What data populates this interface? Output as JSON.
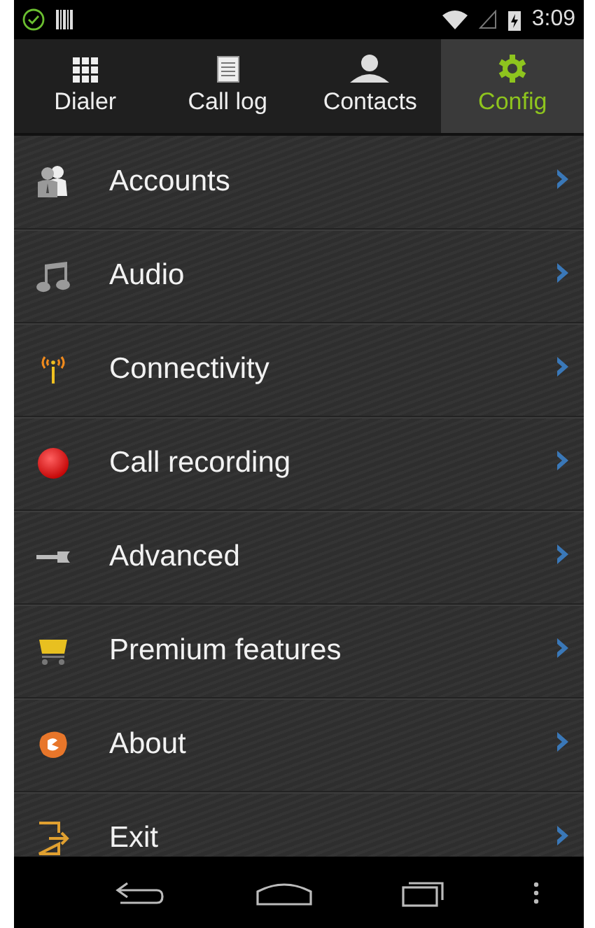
{
  "status_bar": {
    "time": "3:09"
  },
  "tabs": [
    {
      "label": "Dialer",
      "selected": false
    },
    {
      "label": "Call log",
      "selected": false
    },
    {
      "label": "Contacts",
      "selected": false
    },
    {
      "label": "Config",
      "selected": true
    }
  ],
  "menu": [
    {
      "label": "Accounts"
    },
    {
      "label": "Audio"
    },
    {
      "label": "Connectivity"
    },
    {
      "label": "Call recording"
    },
    {
      "label": "Advanced"
    },
    {
      "label": "Premium features"
    },
    {
      "label": "About"
    },
    {
      "label": "Exit"
    }
  ]
}
